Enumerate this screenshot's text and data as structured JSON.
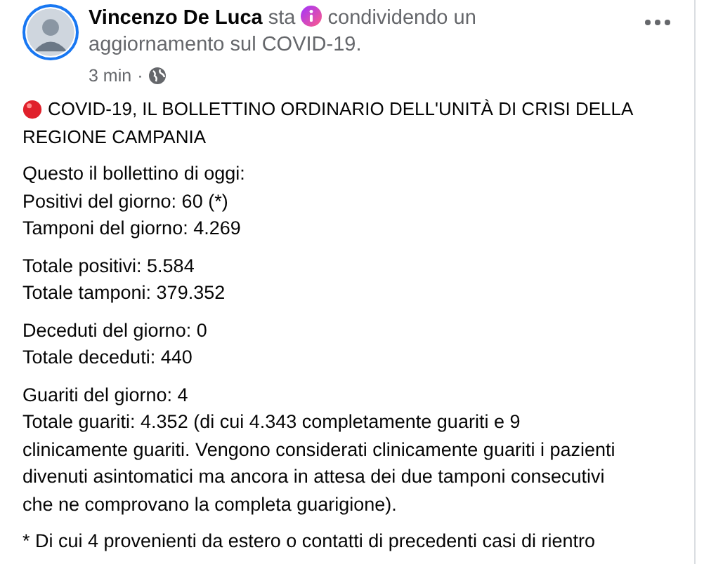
{
  "post": {
    "author": "Vincenzo De Luca",
    "verb": "sta",
    "activity": [
      "condividendo un",
      "aggiornamento sul COVID-19."
    ],
    "time": "3 min",
    "separator": "·",
    "title": [
      "COVID-19, IL BOLLETTINO ORDINARIO DELL'UNITÀ DI CRISI DELLA",
      "REGIONE CAMPANIA"
    ],
    "paragraphs": [
      {
        "lines": [
          "Questo il bollettino di oggi:",
          "Positivi del giorno: 60 (*)",
          "Tamponi del giorno: 4.269"
        ]
      },
      {
        "lines": [
          "Totale positivi: 5.584",
          "Totale tamponi: 379.352"
        ]
      },
      {
        "lines": [
          "Deceduti del giorno: 0",
          "Totale deceduti: 440"
        ]
      },
      {
        "lines": [
          "Guariti del giorno: 4",
          "Totale guariti: 4.352 (di cui 4.343 completamente guariti e 9 clinicamente guariti. Vengono considerati clinicamente guariti i pazienti divenuti asintomatici ma ancora in attesa dei due tamponi consecutivi che ne comprovano la completa guarigione)."
        ]
      },
      {
        "lines": [
          "* Di cui 4 provenienti da estero o contatti di precedenti casi di rientro"
        ]
      }
    ]
  }
}
